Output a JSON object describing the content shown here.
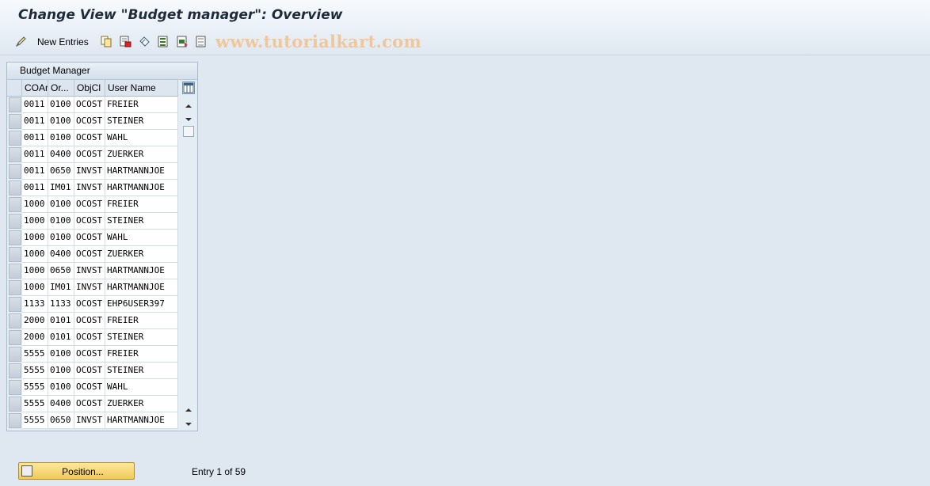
{
  "window": {
    "title": "Change View \"Budget manager\": Overview"
  },
  "toolbar": {
    "new_entries_label": "New Entries",
    "watermark": "www.tutorialkart.com",
    "icons": [
      "change-display-icon",
      "copy-icon",
      "delete-icon",
      "undo-icon",
      "select-all-icon",
      "select-block-icon",
      "deselect-all-icon"
    ]
  },
  "table": {
    "title": "Budget Manager",
    "columns": [
      "COAr",
      "Or...",
      "ObjCl",
      "User Name"
    ],
    "rows": [
      [
        "0011",
        "0100",
        "OCOST",
        "FREIER"
      ],
      [
        "0011",
        "0100",
        "OCOST",
        "STEINER"
      ],
      [
        "0011",
        "0100",
        "OCOST",
        "WAHL"
      ],
      [
        "0011",
        "0400",
        "OCOST",
        "ZUERKER"
      ],
      [
        "0011",
        "0650",
        "INVST",
        "HARTMANNJOE"
      ],
      [
        "0011",
        "IM01",
        "INVST",
        "HARTMANNJOE"
      ],
      [
        "1000",
        "0100",
        "OCOST",
        "FREIER"
      ],
      [
        "1000",
        "0100",
        "OCOST",
        "STEINER"
      ],
      [
        "1000",
        "0100",
        "OCOST",
        "WAHL"
      ],
      [
        "1000",
        "0400",
        "OCOST",
        "ZUERKER"
      ],
      [
        "1000",
        "0650",
        "INVST",
        "HARTMANNJOE"
      ],
      [
        "1000",
        "IM01",
        "INVST",
        "HARTMANNJOE"
      ],
      [
        "1133",
        "1133",
        "OCOST",
        "EHP6USER397"
      ],
      [
        "2000",
        "0101",
        "OCOST",
        "FREIER"
      ],
      [
        "2000",
        "0101",
        "OCOST",
        "STEINER"
      ],
      [
        "5555",
        "0100",
        "OCOST",
        "FREIER"
      ],
      [
        "5555",
        "0100",
        "OCOST",
        "STEINER"
      ],
      [
        "5555",
        "0100",
        "OCOST",
        "WAHL"
      ],
      [
        "5555",
        "0400",
        "OCOST",
        "ZUERKER"
      ],
      [
        "5555",
        "0650",
        "INVST",
        "HARTMANNJOE"
      ]
    ]
  },
  "footer": {
    "position_button": "Position...",
    "entry_text": "Entry 1 of 59"
  }
}
